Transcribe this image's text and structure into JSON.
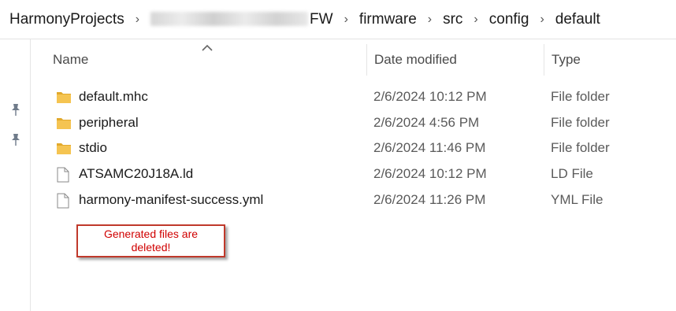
{
  "breadcrumb": {
    "items": [
      "HarmonyProjects",
      "FW",
      "firmware",
      "src",
      "config",
      "default"
    ],
    "separator": "›",
    "blurred_segment_icon": "redacted-text"
  },
  "columns": {
    "name": "Name",
    "date_modified": "Date modified",
    "type": "Type"
  },
  "files": [
    {
      "name": "default.mhc",
      "date": "2/6/2024 10:12 PM",
      "type": "File folder",
      "icon": "folder-icon"
    },
    {
      "name": "peripheral",
      "date": "2/6/2024 4:56 PM",
      "type": "File folder",
      "icon": "folder-icon"
    },
    {
      "name": "stdio",
      "date": "2/6/2024 11:46 PM",
      "type": "File folder",
      "icon": "folder-icon"
    },
    {
      "name": "ATSAMC20J18A.ld",
      "date": "2/6/2024 10:12 PM",
      "type": "LD File",
      "icon": "file-icon"
    },
    {
      "name": "harmony-manifest-success.yml",
      "date": "2/6/2024 11:26 PM",
      "type": "YML File",
      "icon": "file-icon"
    }
  ],
  "annotation": {
    "text": "Generated files are deleted!"
  },
  "colors": {
    "folder": "#f5c451",
    "folder_dark": "#e2a92c",
    "annotation_border": "#c0392b",
    "annotation_text": "#d00000"
  }
}
